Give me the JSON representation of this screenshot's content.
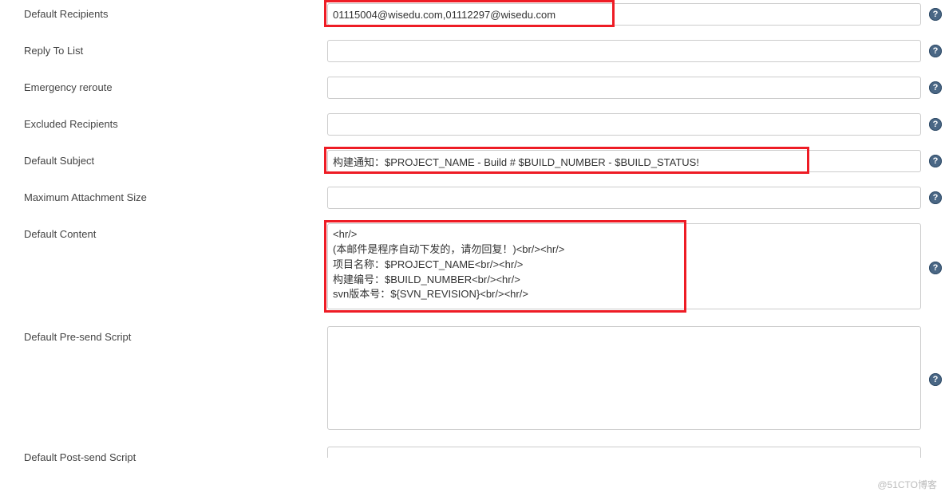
{
  "fields": {
    "default_recipients": {
      "label": "Default Recipients",
      "value": "01115004@wisedu.com,01112297@wisedu.com"
    },
    "reply_to_list": {
      "label": "Reply To List",
      "value": ""
    },
    "emergency_reroute": {
      "label": "Emergency reroute",
      "value": ""
    },
    "excluded_recipients": {
      "label": "Excluded Recipients",
      "value": ""
    },
    "default_subject": {
      "label": "Default Subject",
      "value": "构建通知：$PROJECT_NAME - Build # $BUILD_NUMBER - $BUILD_STATUS!"
    },
    "max_attachment_size": {
      "label": "Maximum Attachment Size",
      "value": ""
    },
    "default_content": {
      "label": "Default Content",
      "value": "<hr/>\n(本邮件是程序自动下发的，请勿回复！)<br/><hr/>\n项目名称：$PROJECT_NAME<br/><hr/>\n构建编号：$BUILD_NUMBER<br/><hr/>\nsvn版本号：${SVN_REVISION}<br/><hr/>"
    },
    "default_presend_script": {
      "label": "Default Pre-send Script",
      "value": ""
    },
    "default_postsend_script": {
      "label": "Default Post-send Script",
      "value": ""
    }
  },
  "help_glyph": "?",
  "watermark": "@51CTO博客"
}
